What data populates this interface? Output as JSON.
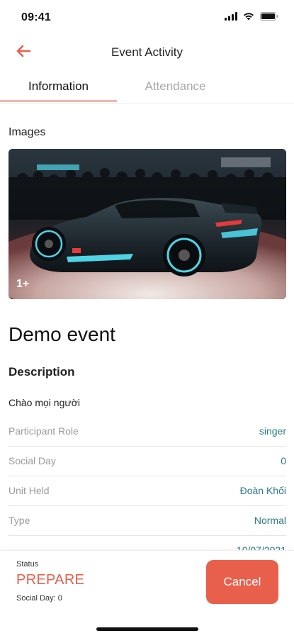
{
  "status_bar": {
    "time": "09:41",
    "icons": [
      "cellular-signal-icon",
      "wifi-icon",
      "battery-icon"
    ]
  },
  "nav": {
    "title": "Event Activity",
    "back_icon": "arrow-left-icon"
  },
  "tabs": [
    {
      "label": "Information",
      "active": true
    },
    {
      "label": "Attendance",
      "active": false
    }
  ],
  "images": {
    "label": "Images",
    "count_badge": "1+"
  },
  "event": {
    "title": "Demo event",
    "description_heading": "Description",
    "description_text": "Chào mọi người"
  },
  "details": [
    {
      "label": "Participant Role",
      "value": "singer"
    },
    {
      "label": "Social Day",
      "value": "0"
    },
    {
      "label": "Unit Held",
      "value": "Đoàn Khối"
    },
    {
      "label": "Type",
      "value": "Normal"
    },
    {
      "label": "",
      "value": "10/07/2021"
    }
  ],
  "footer": {
    "status_caption": "Status",
    "status_value": "PREPARE",
    "social_day_line": "Social Day: 0",
    "cancel_label": "Cancel"
  },
  "colors": {
    "accent": "#e8604c",
    "value_text": "#2c7a8a",
    "tab_underline": "#f2b8ae",
    "muted_label": "#9b9b9b"
  }
}
